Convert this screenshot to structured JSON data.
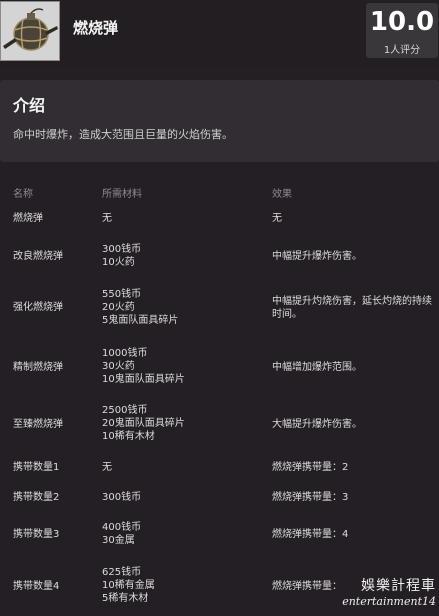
{
  "header": {
    "title": "燃烧弹",
    "thumbnail_icon": "incendiary-grenade-icon",
    "score": "10.0",
    "rating_count": "1人评分"
  },
  "intro": {
    "heading": "介绍",
    "text": "命中时爆炸，造成大范围且巨量的火焰伤害。"
  },
  "table": {
    "headers": {
      "name": "名称",
      "materials": "所需材料",
      "effect": "效果"
    },
    "rows": [
      {
        "name": "燃烧弹",
        "materials": [
          "无"
        ],
        "effect": "无"
      },
      {
        "name": "改良燃烧弹",
        "materials": [
          "300钱币",
          "10火药"
        ],
        "effect": "中幅提升爆炸伤害。"
      },
      {
        "name": "强化燃烧弹",
        "materials": [
          "550钱币",
          "20火药",
          "5鬼面队面具碎片"
        ],
        "effect": "中幅提升灼烧伤害，延长灼烧的持续时间。"
      },
      {
        "name": "精制燃烧弹",
        "materials": [
          "1000钱币",
          "30火药",
          "10鬼面队面具碎片"
        ],
        "effect": "中幅增加爆炸范围。"
      },
      {
        "name": "至臻燃烧弹",
        "materials": [
          "2500钱币",
          "20鬼面队面具碎片",
          "10稀有木材"
        ],
        "effect": "大幅提升爆炸伤害。"
      },
      {
        "name": "携带数量1",
        "materials": [
          "无"
        ],
        "effect": "燃烧弹携带量：2"
      },
      {
        "name": "携带数量2",
        "materials": [
          "300钱币"
        ],
        "effect": "燃烧弹携带量：3"
      },
      {
        "name": "携带数量3",
        "materials": [
          "400钱币",
          "30金属"
        ],
        "effect": "燃烧弹携带量：4"
      },
      {
        "name": "携带数量4",
        "materials": [
          "625钱币",
          "10稀有金属",
          "5稀有木材"
        ],
        "effect": "燃烧弹携带量："
      }
    ]
  },
  "watermark": {
    "line1": "娛樂計程車",
    "line2": "entertainment14"
  },
  "colors": {
    "background": "#241f24",
    "card": "#322d33",
    "score_box": "#3a373b",
    "muted_text": "#8d8a8f"
  }
}
